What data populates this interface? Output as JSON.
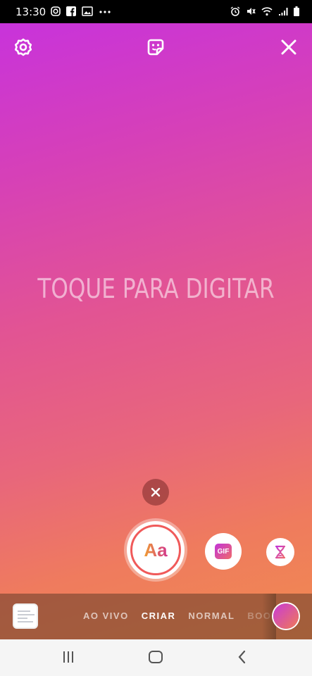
{
  "status_bar": {
    "time": "13:30",
    "left_icons": [
      "instagram-icon",
      "facebook-icon",
      "image-icon",
      "more-dots-icon"
    ],
    "right_icons": [
      "alarm-icon",
      "mute-icon",
      "wifi-icon",
      "signal-icon",
      "battery-icon"
    ]
  },
  "top_bar": {
    "left_icon": "settings-gear-icon",
    "center_icon": "sticker-icon",
    "right_icon": "close-icon"
  },
  "canvas": {
    "prompt": "TOQUE PARA DIGITAR",
    "gradient": [
      "#c833db",
      "#f08a50"
    ]
  },
  "tools": {
    "text_button_label": "Aa",
    "gif_label": "GIF",
    "timer_icon": "hourglass-icon",
    "dismiss_icon": "close-icon"
  },
  "mode_bar": {
    "modes": [
      "AO VIVO",
      "CRIAR",
      "NORMAL",
      "BOO"
    ],
    "selected": "CRIAR"
  },
  "nav_bar": {
    "icons": [
      "recent-apps-icon",
      "home-icon",
      "back-icon"
    ]
  },
  "colors": {
    "accent_start": "#c83ad8",
    "accent_end": "#f07a55"
  }
}
